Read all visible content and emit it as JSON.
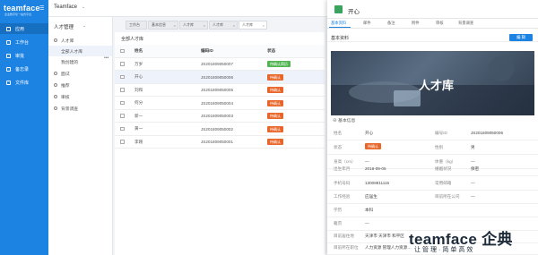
{
  "app": {
    "logo": "teamface",
    "logo_sub": "企业数字化一站式平台",
    "company": "Teamface"
  },
  "left_nav": [
    "应用",
    "工作台",
    "审批",
    "备忘录",
    "文件库"
  ],
  "sub_nav": {
    "title": "人才管理",
    "items": [
      {
        "label": "人才库"
      },
      {
        "label": "全部人才库"
      },
      {
        "label": "我创建的"
      },
      {
        "label": "面试"
      },
      {
        "label": "推荐"
      },
      {
        "label": "审核"
      },
      {
        "label": "背景调查"
      }
    ]
  },
  "tabs": [
    "工作台",
    "基本信息",
    "人才库",
    "人才库",
    "人才库"
  ],
  "list": {
    "title": "全部人才库",
    "columns": [
      "姓名",
      "编码ID",
      "状态"
    ],
    "rows": [
      {
        "name": "万岁",
        "id": "JS201809050007",
        "status": "待确认简历",
        "color": "#52b552"
      },
      {
        "name": "开心",
        "id": "JS201809050006",
        "status": "待确认",
        "color": "#e8662a"
      },
      {
        "name": "刘和",
        "id": "JS201809050005",
        "status": "待确认",
        "color": "#e8662a"
      },
      {
        "name": "何分",
        "id": "JS201809050004",
        "status": "待确认",
        "color": "#e8662a"
      },
      {
        "name": "新一",
        "id": "JS201809050003",
        "status": "待确认",
        "color": "#e8662a"
      },
      {
        "name": "黄一",
        "id": "JS201809050002",
        "status": "待确认",
        "color": "#e8662a"
      },
      {
        "name": "李刚",
        "id": "JS201809050001",
        "status": "待确认",
        "color": "#e8662a"
      }
    ]
  },
  "detail": {
    "title": "开心",
    "tabs": [
      "基本资料",
      "邮件",
      "备注",
      "附件",
      "审核",
      "背景调查"
    ],
    "section_title": "基本资料",
    "edit_label": "编 辑",
    "banner_text": "人才库",
    "basic_label": "基本信息",
    "fields": [
      {
        "l1": "姓名",
        "v1": "开心",
        "l2": "编号ID",
        "v2": "JS201809050006"
      },
      {
        "l1": "状态",
        "v1": "待确认",
        "l2": "性别",
        "v2": "男"
      },
      {
        "l1": "身高（cm）",
        "v1": "—",
        "l2": "体重（kg）",
        "v2": "—"
      },
      {
        "l1": "出生年月",
        "v1": "2018-09-05",
        "l2": "婚姻状况",
        "v2": "保密"
      },
      {
        "l1": "手机号码",
        "v1": "13008811115",
        "l2": "常用邮箱",
        "v2": "—"
      },
      {
        "l1": "工作经验",
        "v1": "应届生",
        "l2": "目前所在公司",
        "v2": "—"
      },
      {
        "l1": "学历",
        "v1": "本科",
        "l2": "",
        "v2": ""
      },
      {
        "l1": "籍贯",
        "v1": "—",
        "l2": "",
        "v2": ""
      },
      {
        "l1": "目前居住地",
        "v1": "天津市 天津市 和平区",
        "l2": "",
        "v2": ""
      },
      {
        "l1": "目前所在职位",
        "v1": "人力资源  管理人力资源…",
        "l2": "",
        "v2": ""
      }
    ]
  },
  "watermark": {
    "main": "teamface 企典",
    "sub": "让管理·简单高效"
  }
}
